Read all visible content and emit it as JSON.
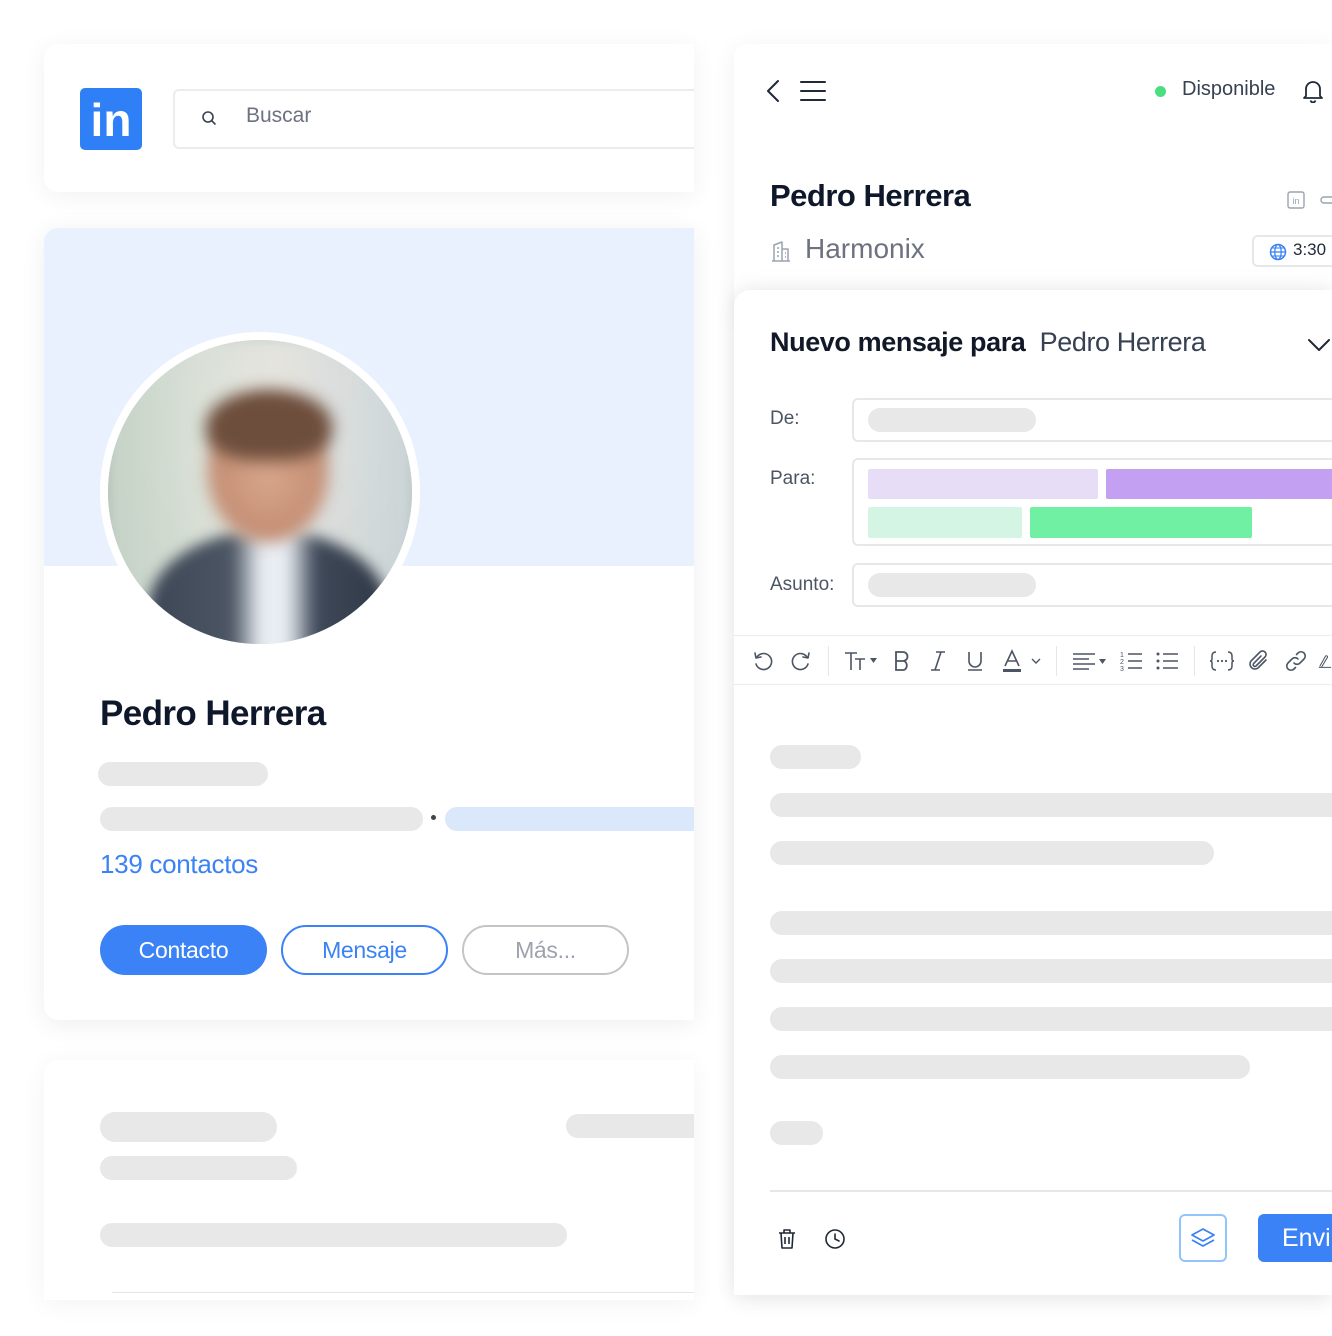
{
  "linkedin": {
    "logo_text": "in",
    "search_placeholder": "Buscar",
    "profile": {
      "name": "Pedro Herrera",
      "connections": "139 contactos"
    },
    "buttons": {
      "contact": "Contacto",
      "message": "Mensaje",
      "more": "Más..."
    }
  },
  "crm": {
    "status": "Disponible",
    "contact_name": "Pedro Herrera",
    "company": "Harmonix",
    "local_time": "3:30",
    "compose": {
      "title_prefix": "Nuevo mensaje para",
      "title_name": "Pedro Herrera",
      "from_label": "De:",
      "to_label": "Para:",
      "subject_label": "Asunto:",
      "send_label": "Envi"
    }
  },
  "colors": {
    "brand_blue": "#3b82f6",
    "linkedin_blue": "#2f7ff6",
    "status_green": "#4ade80",
    "tag_purple_light": "#e7ddf7",
    "tag_purple": "#c4a0f2",
    "tag_green_light": "#d4f5e3",
    "tag_green": "#6ff0a2"
  }
}
